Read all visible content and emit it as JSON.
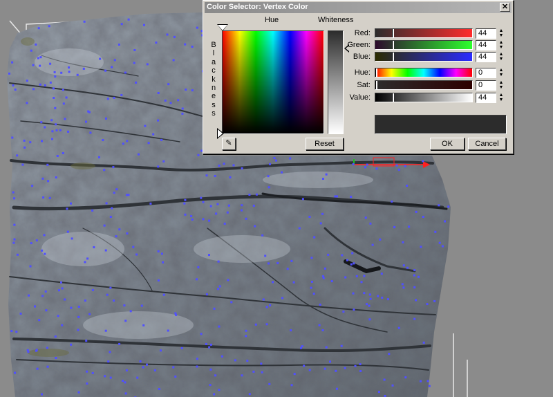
{
  "dialog": {
    "title": "Color Selector: Vertex Color",
    "close_glyph": "✕",
    "hue_label": "Hue",
    "whiteness_label": "Whiteness",
    "blackness_letters": [
      "B",
      "l",
      "a",
      "c",
      "k",
      "n",
      "e",
      "s",
      "s"
    ],
    "eyedropper_icon": "✎",
    "reset_label": "Reset",
    "ok_label": "OK",
    "cancel_label": "Cancel",
    "swatch_color": "#2c2c2c"
  },
  "sliders": {
    "red": {
      "label": "Red:",
      "value": "44",
      "fraction": 0.173,
      "gradient": [
        "#2c2c2c",
        "#ff2c2c"
      ]
    },
    "green": {
      "label": "Green:",
      "value": "44",
      "fraction": 0.173,
      "gradient": [
        "#2c0a2c",
        "#2cff2c"
      ]
    },
    "blue": {
      "label": "Blue:",
      "value": "44",
      "fraction": 0.173,
      "gradient": [
        "#2c2c00",
        "#2c2cff"
      ]
    },
    "hue": {
      "label": "Hue:",
      "value": "0",
      "fraction": 0.0
    },
    "sat": {
      "label": "Sat:",
      "value": "0",
      "fraction": 0.0,
      "gradient": [
        "#2c2c2c",
        "#2c0000"
      ]
    },
    "value": {
      "label": "Value:",
      "value": "44",
      "fraction": 0.173,
      "gradient": [
        "#000000",
        "#ffffff"
      ]
    }
  },
  "spinner_glyphs": {
    "up": "▲",
    "down": "▼"
  },
  "colors": {
    "viewport_bg": "#8b8b8b",
    "rock_base": "#7d8790",
    "vertex_dot": "#5050ff"
  }
}
